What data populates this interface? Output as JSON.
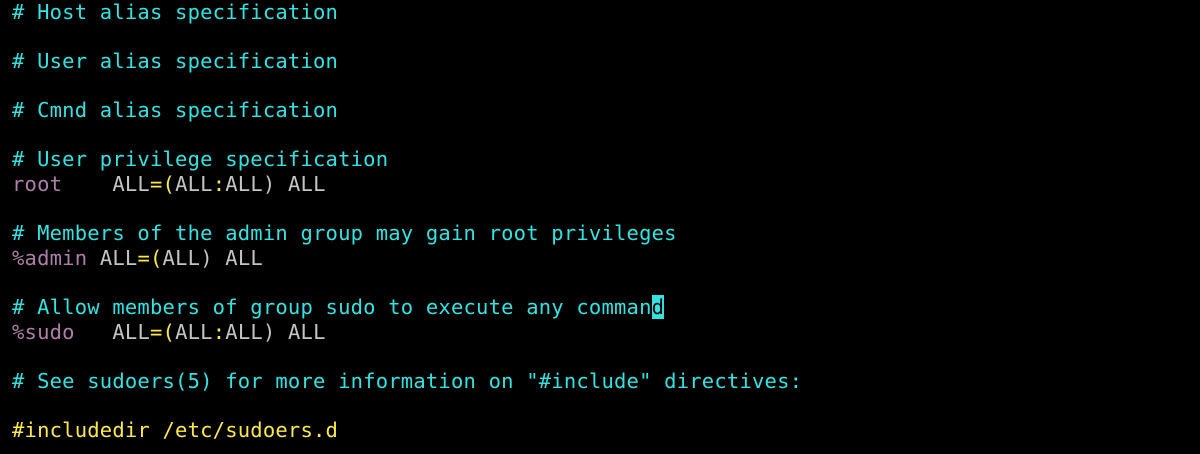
{
  "colors": {
    "background": "#000000",
    "comment": "#34e2e2",
    "user": "#ad7fa8",
    "keyword": "#c4c4c4",
    "symbol": "#fce94f",
    "include": "#fce94f",
    "cursor_bg": "#34e2e2"
  },
  "lines": [
    {
      "segments": [
        {
          "text": "# Host alias specification",
          "role": "comment"
        }
      ]
    },
    {
      "segments": [
        {
          "text": "# User alias specification",
          "role": "comment"
        }
      ]
    },
    {
      "segments": [
        {
          "text": "# Cmnd alias specification",
          "role": "comment"
        }
      ]
    },
    {
      "segments": [
        {
          "text": "# User privilege specification",
          "role": "comment"
        }
      ]
    },
    {
      "segments": [
        {
          "text": "root",
          "role": "user"
        },
        {
          "text": "    ",
          "role": "keyword"
        },
        {
          "text": "ALL",
          "role": "keyword"
        },
        {
          "text": "=(",
          "role": "symbol"
        },
        {
          "text": "ALL",
          "role": "keyword"
        },
        {
          "text": ":",
          "role": "symbol"
        },
        {
          "text": "ALL",
          "role": "keyword"
        },
        {
          "text": ") ",
          "role": "keyword"
        },
        {
          "text": "ALL",
          "role": "keyword"
        }
      ]
    },
    {
      "segments": [
        {
          "text": "# Members of the admin group may gain root privileges",
          "role": "comment"
        }
      ]
    },
    {
      "segments": [
        {
          "text": "%admin",
          "role": "user"
        },
        {
          "text": " ",
          "role": "keyword"
        },
        {
          "text": "ALL",
          "role": "keyword"
        },
        {
          "text": "=(",
          "role": "symbol"
        },
        {
          "text": "ALL",
          "role": "keyword"
        },
        {
          "text": ") ",
          "role": "keyword"
        },
        {
          "text": "ALL",
          "role": "keyword"
        }
      ]
    },
    {
      "segments": [
        {
          "text": "# Allow members of group sudo to execute any comman",
          "role": "comment"
        },
        {
          "text": "d",
          "role": "cursor"
        }
      ]
    },
    {
      "segments": [
        {
          "text": "%sudo",
          "role": "user"
        },
        {
          "text": "   ",
          "role": "keyword"
        },
        {
          "text": "ALL",
          "role": "keyword"
        },
        {
          "text": "=(",
          "role": "symbol"
        },
        {
          "text": "ALL",
          "role": "keyword"
        },
        {
          "text": ":",
          "role": "symbol"
        },
        {
          "text": "ALL",
          "role": "keyword"
        },
        {
          "text": ") ",
          "role": "keyword"
        },
        {
          "text": "ALL",
          "role": "keyword"
        }
      ]
    },
    {
      "segments": [
        {
          "text": "# See sudoers(5) for more information on \"#include\" directives:",
          "role": "comment"
        }
      ]
    },
    {
      "segments": [
        {
          "text": "#includedir /etc/sudoers.d",
          "role": "include"
        }
      ]
    }
  ]
}
